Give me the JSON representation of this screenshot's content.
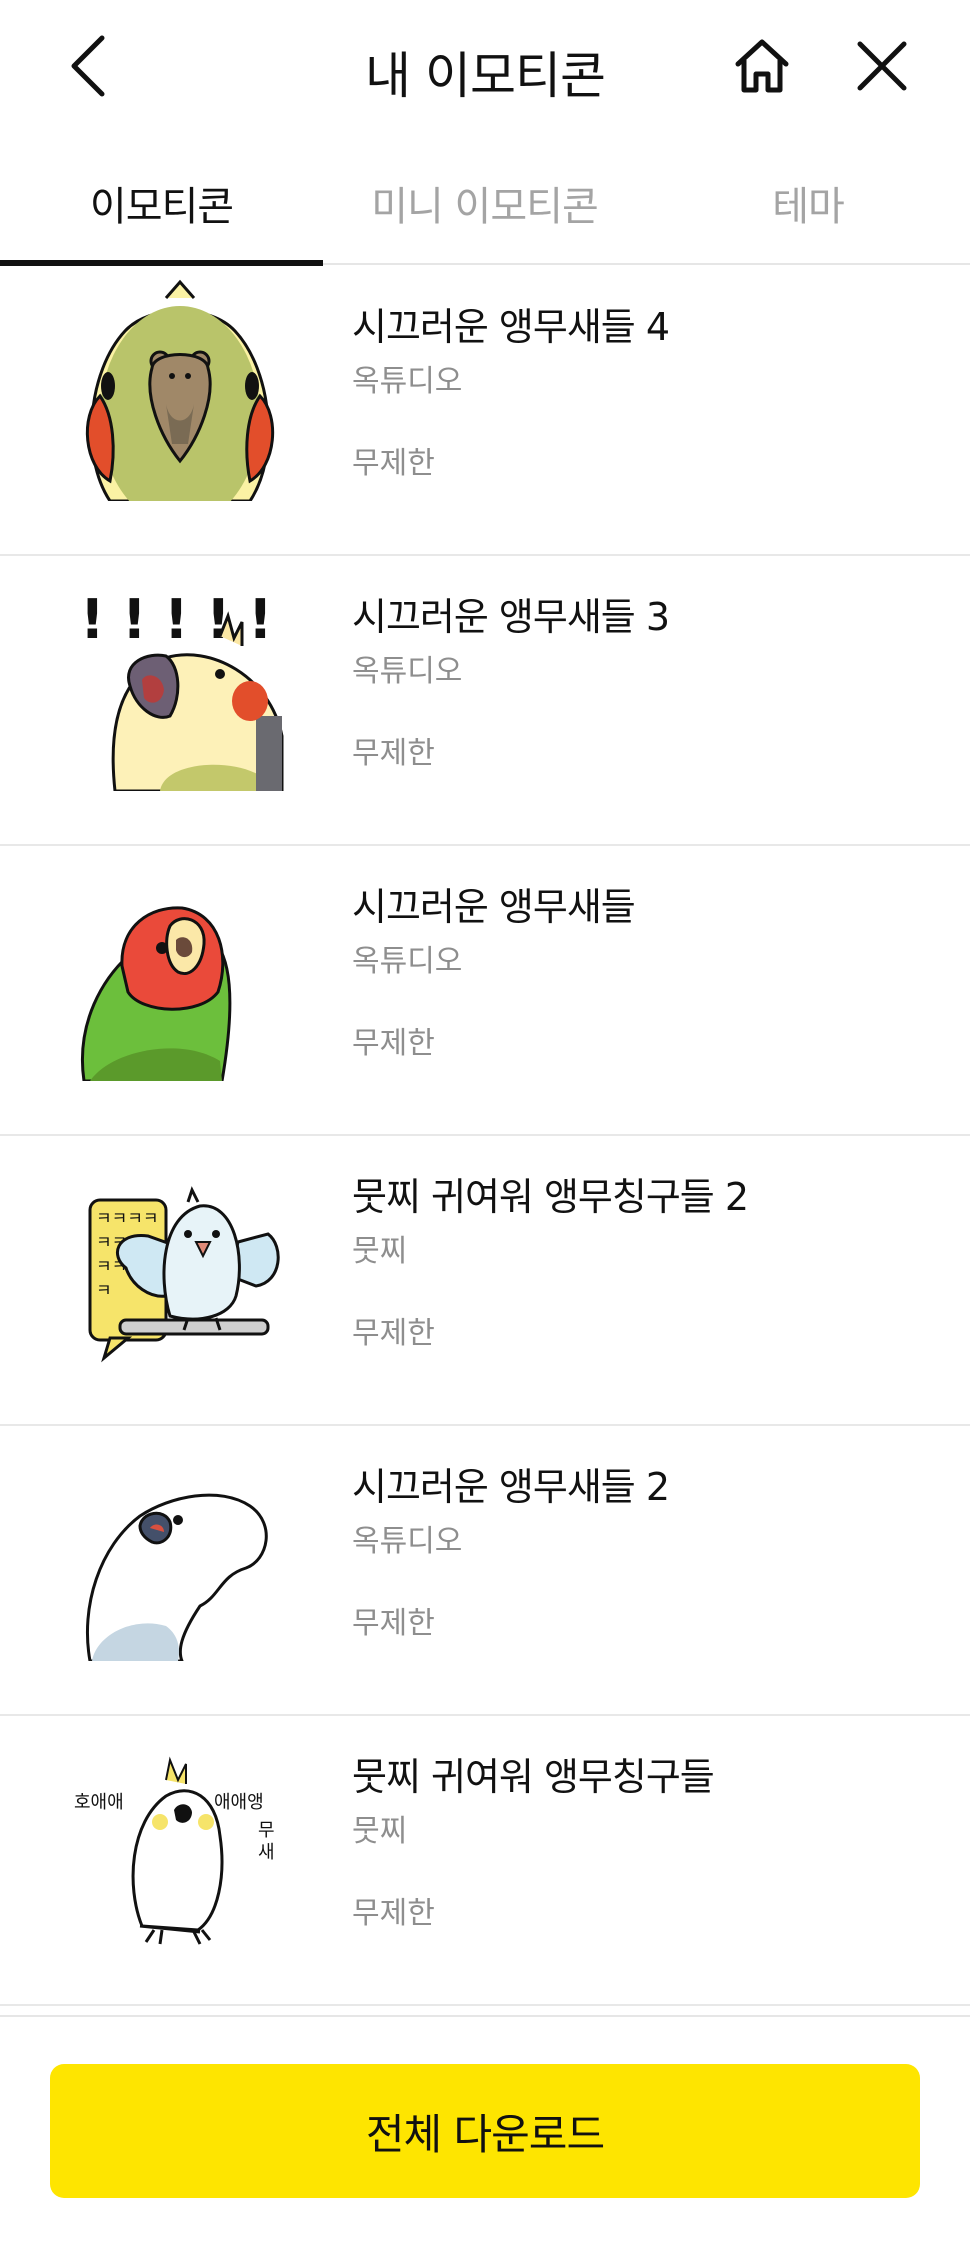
{
  "header": {
    "title": "내 이모티콘",
    "back_icon": "chevron-left-icon",
    "home_icon": "home-icon",
    "close_icon": "close-icon"
  },
  "tabs": [
    {
      "label": "이모티콘",
      "active": true
    },
    {
      "label": "미니 이모티콘",
      "active": false
    },
    {
      "label": "테마",
      "active": false
    }
  ],
  "items": [
    {
      "name": "시끄러운 앵무새들 4",
      "author": "옥튜디오",
      "period": "무제한"
    },
    {
      "name": "시끄러운 앵무새들 3",
      "author": "옥튜디오",
      "period": "무제한"
    },
    {
      "name": "시끄러운 앵무새들",
      "author": "옥튜디오",
      "period": "무제한"
    },
    {
      "name": "뭇찌 귀여워 앵무칭구들 2",
      "author": "뭇찌",
      "period": "무제한"
    },
    {
      "name": "시끄러운 앵무새들 2",
      "author": "옥튜디오",
      "period": "무제한"
    },
    {
      "name": "뭇찌 귀여워 앵무칭구들",
      "author": "뭇찌",
      "period": "무제한"
    }
  ],
  "sticker_text": {
    "speech": "ㅋㅋㅋㅋ",
    "speech_last": "ㅋ",
    "left": "호애애",
    "right": "애애앵",
    "vertical": [
      "무",
      "새"
    ],
    "exclaims": [
      "!",
      "!",
      "!",
      "!",
      "!"
    ]
  },
  "download": {
    "label": "전체 다운로드"
  },
  "colors": {
    "accent": "#fee500",
    "text": "#111111",
    "muted": "#8e8e8e"
  }
}
